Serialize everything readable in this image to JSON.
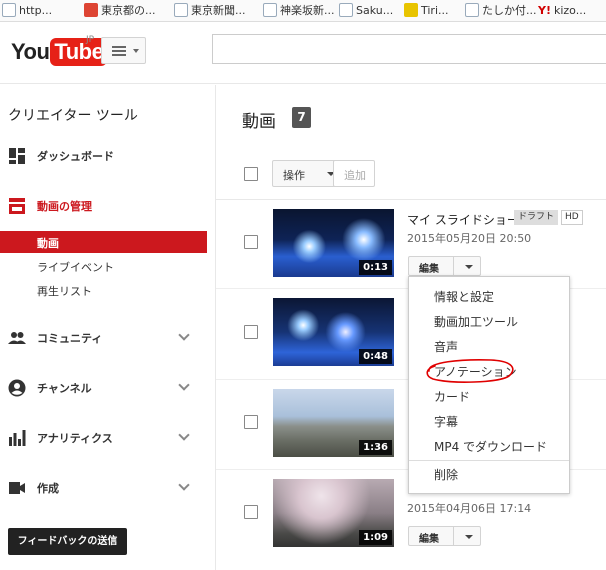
{
  "bookmarks": [
    {
      "label": "http...",
      "icon": "page-icon"
    },
    {
      "label": "東京都の...",
      "icon": "red-bookmark-icon"
    },
    {
      "label": "東京新聞...",
      "icon": "page-icon"
    },
    {
      "label": "神楽坂新...",
      "icon": "page-icon"
    },
    {
      "label": "Saku...",
      "icon": "page-icon"
    },
    {
      "label": "Tiri...",
      "icon": "yellow-bookmark-icon"
    },
    {
      "label": "たしか付...",
      "icon": "page-icon"
    },
    {
      "label": "kizo...",
      "icon": "yahoo-icon"
    }
  ],
  "header": {
    "logo_you": "You",
    "logo_tube": "Tube",
    "logo_region": "JP",
    "search_placeholder": ""
  },
  "sidebar": {
    "title": "クリエイター ツール",
    "items": [
      {
        "label": "ダッシュボード",
        "icon": "dashboard-icon"
      },
      {
        "label": "動画の管理",
        "icon": "video-manager-icon"
      },
      {
        "label": "コミュニティ",
        "icon": "community-icon"
      },
      {
        "label": "チャンネル",
        "icon": "channel-icon"
      },
      {
        "label": "アナリティクス",
        "icon": "analytics-icon"
      },
      {
        "label": "作成",
        "icon": "create-icon"
      }
    ],
    "subitems": [
      {
        "label": "動画"
      },
      {
        "label": "ライブイベント"
      },
      {
        "label": "再生リスト"
      }
    ],
    "feedback": "フィードバックの送信"
  },
  "main": {
    "title": "動画",
    "count": "7",
    "actions_label": "操作",
    "add_label": "追加",
    "edit_label": "編集",
    "videos": [
      {
        "title": "マイ スライドショー",
        "badge_draft": "ドラフト",
        "badge_hd": "HD",
        "date": "2015年05月20日 20:50",
        "duration": "0:13"
      },
      {
        "title": "",
        "date": "",
        "duration": "0:48"
      },
      {
        "title": "",
        "date": "",
        "duration": "1:36"
      },
      {
        "title": "",
        "date": "2015年04月06日 17:14",
        "duration": "1:09"
      }
    ]
  },
  "menu": {
    "items": [
      "情報と設定",
      "動画加工ツール",
      "音声",
      "アノテーション",
      "カード",
      "字幕",
      "MP4 でダウンロード",
      "削除"
    ]
  },
  "colors": {
    "accent_red": "#cc181e",
    "annotation_circle": "#e00000"
  }
}
